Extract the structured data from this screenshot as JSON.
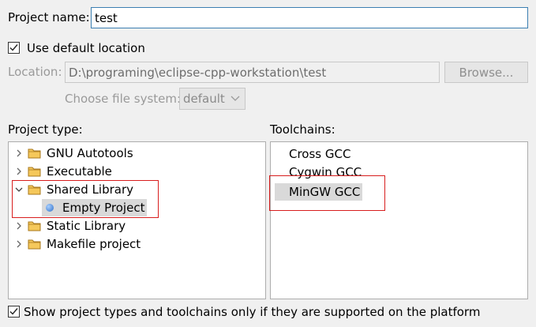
{
  "project_name": {
    "label": "Project name:",
    "value": "test"
  },
  "use_default_location": {
    "label": "Use default location",
    "checked": true
  },
  "location": {
    "label": "Location:",
    "value": "D:\\programing\\eclipse-cpp-workstation\\test",
    "browse_label": "Browse..."
  },
  "file_system": {
    "label": "Choose file system:",
    "selected": "default"
  },
  "project_type": {
    "label": "Project type:",
    "items": [
      {
        "label": "GNU Autotools",
        "expanded": false
      },
      {
        "label": "Executable",
        "expanded": false
      },
      {
        "label": "Shared Library",
        "expanded": true,
        "children": [
          {
            "label": "Empty Project",
            "selected": true
          }
        ]
      },
      {
        "label": "Static Library",
        "expanded": false
      },
      {
        "label": "Makefile project",
        "expanded": false
      }
    ]
  },
  "toolchains": {
    "label": "Toolchains:",
    "items": [
      {
        "label": "Cross GCC",
        "selected": false
      },
      {
        "label": "Cygwin GCC",
        "selected": false
      },
      {
        "label": "MinGW GCC",
        "selected": true
      }
    ]
  },
  "show_supported_only": {
    "label": "Show project types and toolchains only if they are supported on the platform",
    "checked": true
  },
  "colors": {
    "highlight_box": "#d81e1e",
    "selection_bg": "#d9d9d9",
    "focus_border": "#3c7fb1"
  }
}
